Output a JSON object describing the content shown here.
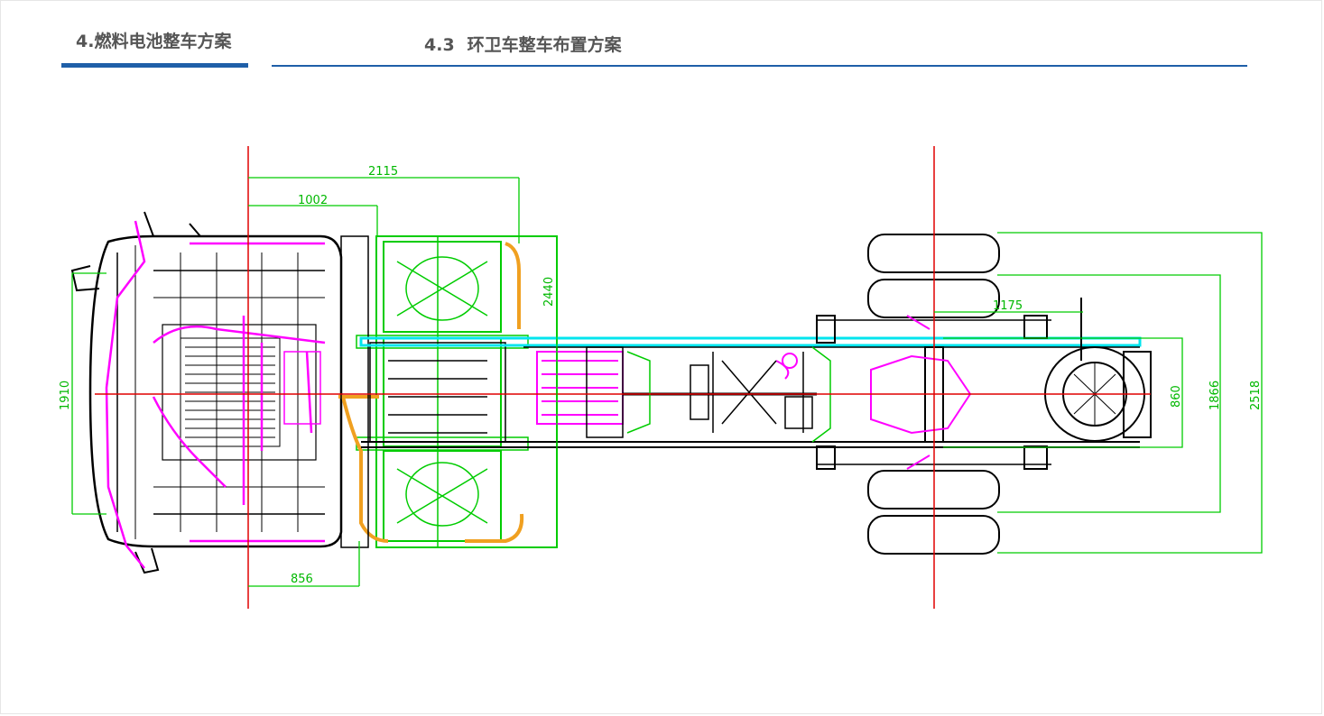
{
  "header": {
    "section_title": "4.燃料电池整车方案",
    "subsection_number": "4.3",
    "subsection_title": "环卫车整车布置方案"
  },
  "drawing": {
    "dimensions": {
      "d2115": "2115",
      "d1002": "1002",
      "d2440": "2440",
      "d1910": "1910",
      "d856": "856",
      "d1175": "1175",
      "d860": "860",
      "d1866": "1866",
      "d2518": "2518"
    },
    "colors": {
      "dimension": "#00cc00",
      "centerline": "#e00000",
      "frame_rail": "#00e5ee",
      "electrical": "#ff00ff",
      "piping": "#f0a020",
      "outline": "#000000",
      "accent": "#1f5fa8"
    }
  }
}
